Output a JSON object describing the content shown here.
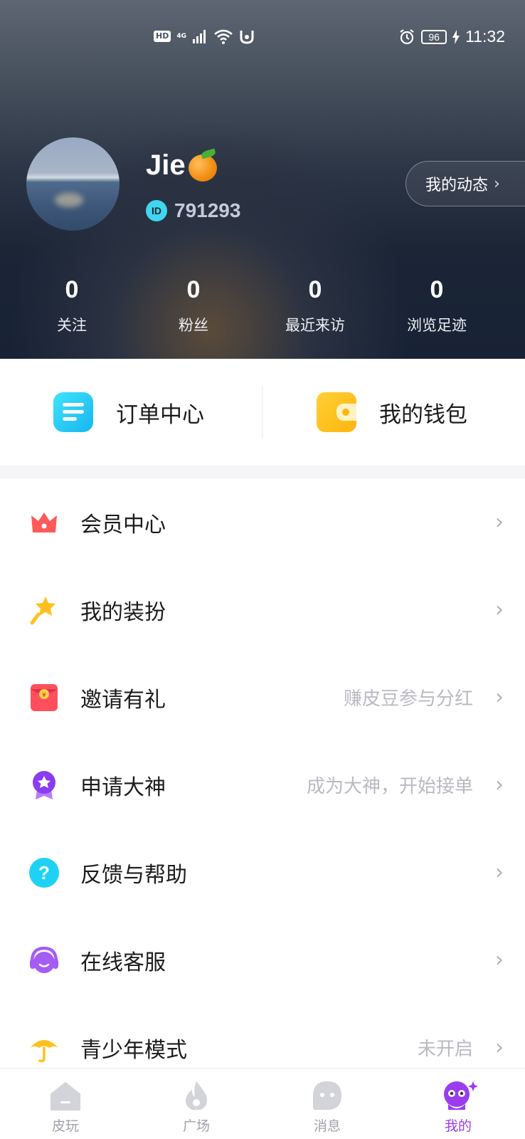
{
  "status_bar": {
    "hd": "HD",
    "network": "4G",
    "battery": "96",
    "time": "11:32"
  },
  "profile": {
    "username": "Jie",
    "id_badge": "ID",
    "id_value": "791293",
    "dynamics_button": "我的动态"
  },
  "stats": [
    {
      "value": "0",
      "label": "关注"
    },
    {
      "value": "0",
      "label": "粉丝"
    },
    {
      "value": "0",
      "label": "最近来访"
    },
    {
      "value": "0",
      "label": "浏览足迹"
    }
  ],
  "quick_actions": {
    "orders": "订单中心",
    "wallet": "我的钱包"
  },
  "menu": [
    {
      "label": "会员中心",
      "hint": "",
      "icon": "crown-icon"
    },
    {
      "label": "我的装扮",
      "hint": "",
      "icon": "magic-wand-icon"
    },
    {
      "label": "邀请有礼",
      "hint": "赚皮豆参与分红",
      "icon": "red-envelope-icon"
    },
    {
      "label": "申请大神",
      "hint": "成为大神，开始接单",
      "icon": "medal-icon"
    },
    {
      "label": "反馈与帮助",
      "hint": "",
      "icon": "question-icon"
    },
    {
      "label": "在线客服",
      "hint": "",
      "icon": "headset-icon"
    },
    {
      "label": "青少年模式",
      "hint": "未开启",
      "icon": "umbrella-icon"
    }
  ],
  "tabs": [
    {
      "label": "皮玩",
      "icon": "home-icon"
    },
    {
      "label": "广场",
      "icon": "flame-icon"
    },
    {
      "label": "消息",
      "icon": "chat-icon"
    },
    {
      "label": "我的",
      "icon": "profile-mascot-icon",
      "active": true
    }
  ],
  "colors": {
    "accent": "#9a3cf0",
    "header_dark": "#172234",
    "hint_gray": "#b9b9c2"
  }
}
